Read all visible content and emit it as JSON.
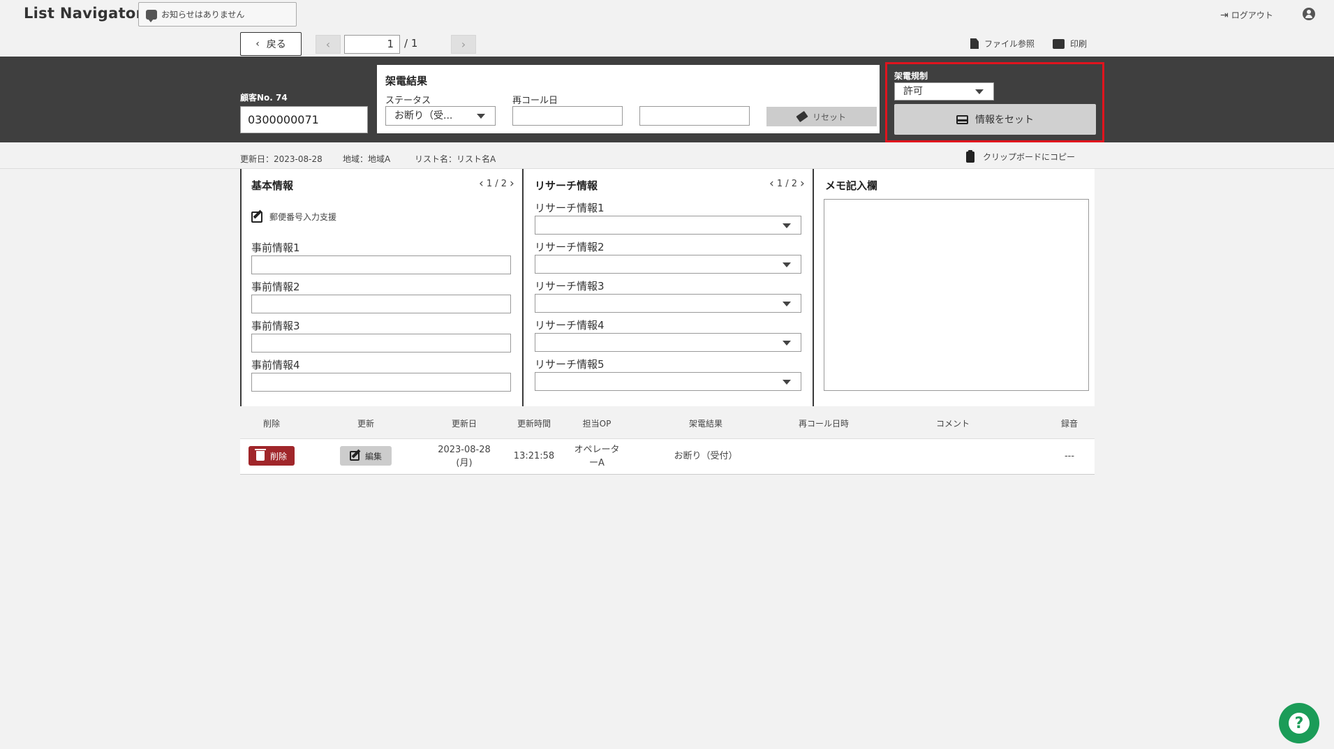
{
  "header": {
    "logo": "List Navigator.",
    "notice": "お知らせはありません",
    "logout_label": "ログアウト"
  },
  "nav": {
    "back_label": "戻る",
    "page_value": "1",
    "page_total": "/ 1",
    "file_ref_label": "ファイル参照",
    "print_label": "印刷"
  },
  "customer": {
    "label": "顧客No. 74",
    "number": "0300000071"
  },
  "call_result": {
    "title": "架電結果",
    "status_label": "ステータス",
    "status_value": "お断り（受...",
    "recall_label": "再コール日",
    "recall_date": "",
    "recall_time": "",
    "reset_label": "リセット"
  },
  "call_regulation": {
    "label": "架電規制",
    "value": "許可",
    "set_button": "情報をセット"
  },
  "meta": {
    "updated": "更新日：2023-08-28",
    "region": "地域：地域A",
    "list_name": "リスト名：リスト名A",
    "clipboard_label": "クリップボードにコピー"
  },
  "basic_info": {
    "title": "基本情報",
    "pager": "1 / 2",
    "postal_label": "郵便番号入力支援",
    "fields": [
      {
        "label": "事前情報1",
        "value": ""
      },
      {
        "label": "事前情報2",
        "value": ""
      },
      {
        "label": "事前情報3",
        "value": ""
      },
      {
        "label": "事前情報4",
        "value": ""
      }
    ]
  },
  "research_info": {
    "title": "リサーチ情報",
    "pager": "1 / 2",
    "fields": [
      {
        "label": "リサーチ情報1",
        "value": ""
      },
      {
        "label": "リサーチ情報2",
        "value": ""
      },
      {
        "label": "リサーチ情報3",
        "value": ""
      },
      {
        "label": "リサーチ情報4",
        "value": ""
      },
      {
        "label": "リサーチ情報5",
        "value": ""
      }
    ]
  },
  "memo": {
    "title": "メモ記入欄",
    "value": ""
  },
  "history": {
    "columns": [
      "削除",
      "更新",
      "更新日",
      "更新時間",
      "担当OP",
      "架電結果",
      "再コール日時",
      "コメント",
      "録音"
    ],
    "rows": [
      {
        "delete_label": "削除",
        "edit_label": "編集",
        "date_line1": "2023-08-28",
        "date_line2": "(月)",
        "time": "13:21:58",
        "operator_line1": "オペレータ",
        "operator_line2": "ーA",
        "result": "お断り（受付）",
        "recall": "",
        "comment": "",
        "recording": "---"
      }
    ]
  },
  "colors": {
    "band": "#3f3f3f",
    "highlight": "#e0141e",
    "delete": "#a0262a",
    "help": "#1b9c58"
  }
}
